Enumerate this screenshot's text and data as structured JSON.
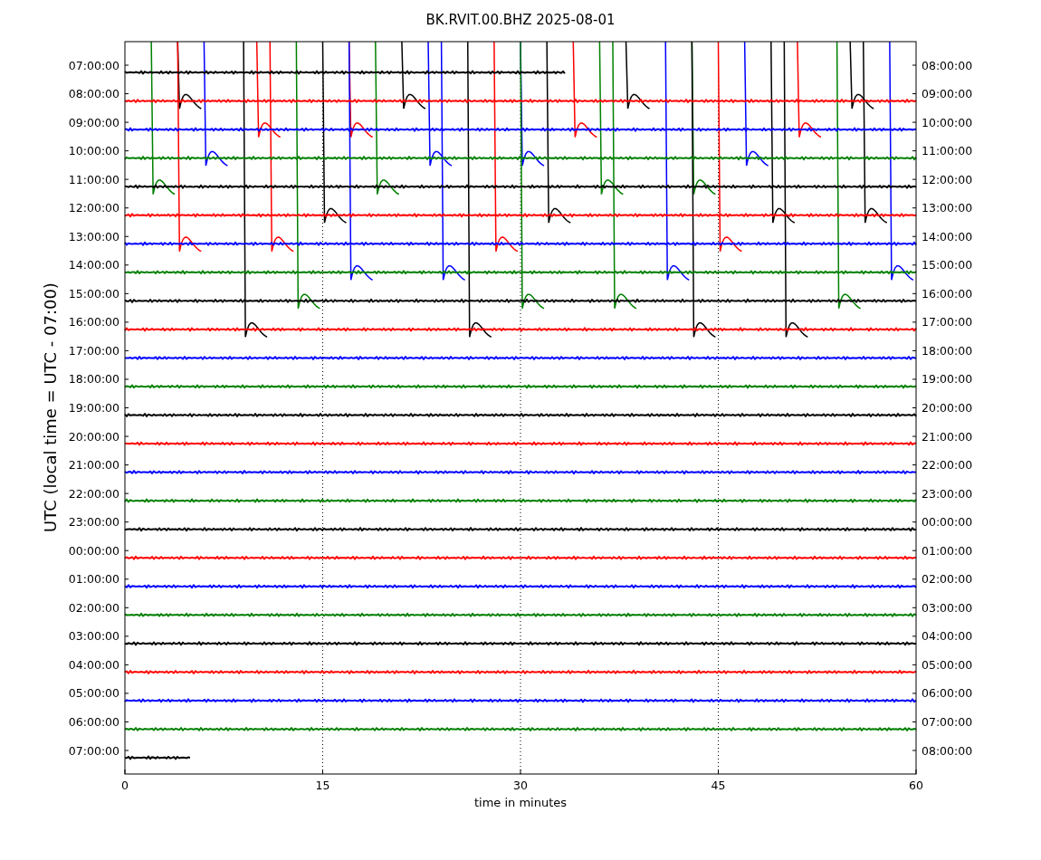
{
  "plot": {
    "title": "BK.RVIT.00.BHZ 2025-08-01",
    "ylabel": "UTC (local time = UTC - 07:00)",
    "xlabel": "time in minutes",
    "xticks": [
      "0",
      "15",
      "30",
      "45",
      "60"
    ],
    "rows": [
      {
        "left": "07:00:00",
        "right": "08:00:00",
        "color": "#000000"
      },
      {
        "left": "08:00:00",
        "right": "09:00:00",
        "color": "#ff0000"
      },
      {
        "left": "09:00:00",
        "right": "10:00:00",
        "color": "#0000ff"
      },
      {
        "left": "10:00:00",
        "right": "11:00:00",
        "color": "#008000"
      },
      {
        "left": "11:00:00",
        "right": "12:00:00",
        "color": "#000000"
      },
      {
        "left": "12:00:00",
        "right": "13:00:00",
        "color": "#ff0000"
      },
      {
        "left": "13:00:00",
        "right": "14:00:00",
        "color": "#0000ff"
      },
      {
        "left": "14:00:00",
        "right": "15:00:00",
        "color": "#008000"
      },
      {
        "left": "15:00:00",
        "right": "16:00:00",
        "color": "#000000"
      },
      {
        "left": "16:00:00",
        "right": "17:00:00",
        "color": "#ff0000"
      },
      {
        "left": "17:00:00",
        "right": "18:00:00",
        "color": "#0000ff"
      },
      {
        "left": "18:00:00",
        "right": "19:00:00",
        "color": "#008000"
      },
      {
        "left": "19:00:00",
        "right": "20:00:00",
        "color": "#000000"
      },
      {
        "left": "20:00:00",
        "right": "21:00:00",
        "color": "#ff0000"
      },
      {
        "left": "21:00:00",
        "right": "22:00:00",
        "color": "#0000ff"
      },
      {
        "left": "22:00:00",
        "right": "23:00:00",
        "color": "#008000"
      },
      {
        "left": "23:00:00",
        "right": "00:00:00",
        "color": "#000000"
      },
      {
        "left": "00:00:00",
        "right": "01:00:00",
        "color": "#ff0000"
      },
      {
        "left": "01:00:00",
        "right": "02:00:00",
        "color": "#0000ff"
      },
      {
        "left": "02:00:00",
        "right": "03:00:00",
        "color": "#008000"
      },
      {
        "left": "03:00:00",
        "right": "04:00:00",
        "color": "#000000"
      },
      {
        "left": "04:00:00",
        "right": "05:00:00",
        "color": "#ff0000"
      },
      {
        "left": "05:00:00",
        "right": "06:00:00",
        "color": "#0000ff"
      },
      {
        "left": "06:00:00",
        "right": "07:00:00",
        "color": "#008000"
      },
      {
        "left": "07:00:00",
        "right": "08:00:00",
        "color": "#000000"
      }
    ]
  }
}
